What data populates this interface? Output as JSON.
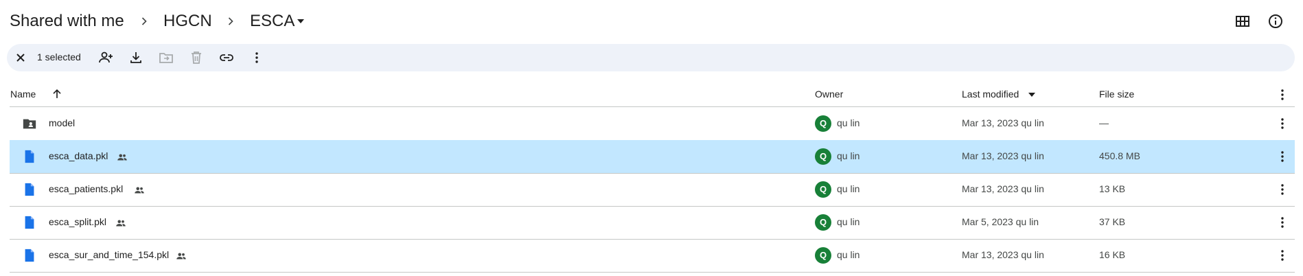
{
  "breadcrumb": {
    "items": [
      "Shared with me",
      "HGCN",
      "ESCA"
    ],
    "separator_icon": "chevron-right-icon",
    "dropdown_icon": "arrow-drop-down-icon"
  },
  "top_actions": {
    "layout_icon": "grid-view-icon",
    "info_icon": "info-icon"
  },
  "selection_bar": {
    "count_text": "1 selected",
    "icons": [
      "close-icon",
      "share-icon",
      "download-icon",
      "move-icon",
      "trash-icon",
      "link-icon",
      "more-vert-icon"
    ],
    "disabled": [
      "move-icon",
      "trash-icon"
    ]
  },
  "table": {
    "columns": {
      "name": "Name",
      "owner": "Owner",
      "modified": "Last modified",
      "size": "File size"
    },
    "sort": {
      "name_arrow": "arrow-upward-icon",
      "modified_arrow": "arrow-drop-down-icon"
    },
    "rows": [
      {
        "name": "model",
        "type": "shared-folder",
        "shared": false,
        "owner_initial": "Q",
        "owner": "qu lin",
        "modified": "Mar 13, 2023",
        "modified_by": "qu lin",
        "size": "—",
        "selected": false
      },
      {
        "name": "esca_data.pkl",
        "type": "file",
        "shared": true,
        "owner_initial": "Q",
        "owner": "qu lin",
        "modified": "Mar 13, 2023",
        "modified_by": "qu lin",
        "size": "450.8 MB",
        "selected": true
      },
      {
        "name": "esca_patients.pkl",
        "type": "file",
        "shared": true,
        "owner_initial": "Q",
        "owner": "qu lin",
        "modified": "Mar 13, 2023",
        "modified_by": "qu lin",
        "size": "13 KB",
        "selected": false
      },
      {
        "name": "esca_split.pkl",
        "type": "file",
        "shared": true,
        "owner_initial": "Q",
        "owner": "qu lin",
        "modified": "Mar 5, 2023",
        "modified_by": "qu lin",
        "size": "37 KB",
        "selected": false
      },
      {
        "name": "esca_sur_and_time_154.pkl",
        "type": "file",
        "shared": true,
        "owner_initial": "Q",
        "owner": "qu lin",
        "modified": "Mar 13, 2023",
        "modified_by": "qu lin",
        "size": "16 KB",
        "selected": false
      }
    ]
  },
  "colors": {
    "selected_row": "#c2e7ff",
    "selection_bar": "#eef2f9",
    "file_icon": "#1a73e8",
    "avatar": "#188038"
  }
}
